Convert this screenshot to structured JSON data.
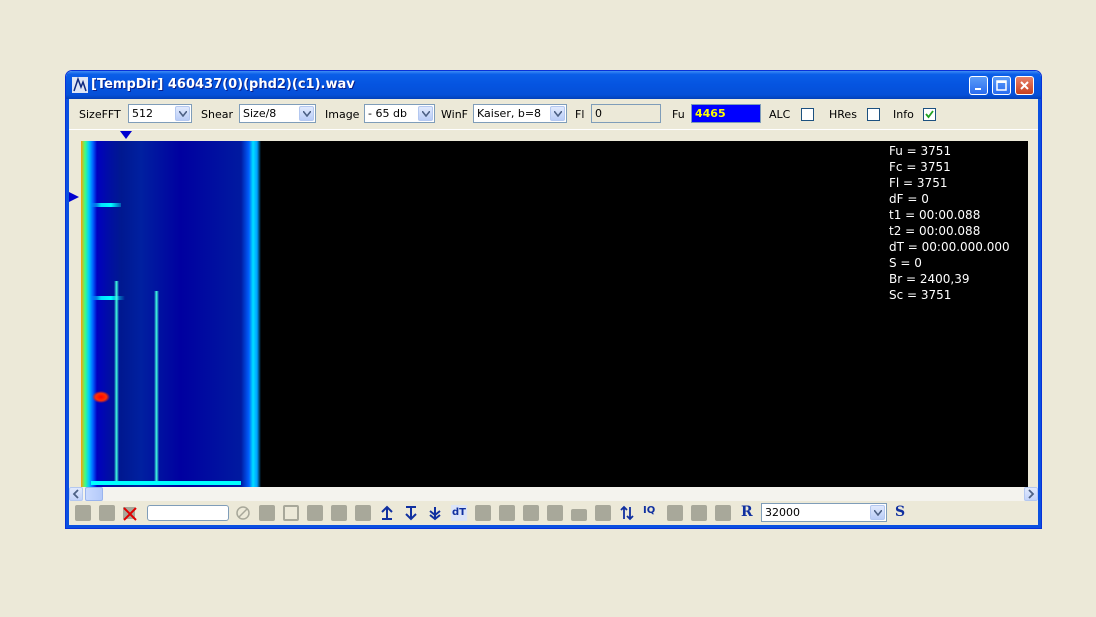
{
  "window": {
    "title": "[TempDir] 460437(0)(phd2)(c1).wav"
  },
  "toolbar": {
    "sizefft_label": "SizeFFT",
    "sizefft_value": "512",
    "shear_label": "Shear",
    "shear_value": "Size/8",
    "image_label": "Image",
    "image_value": "- 65 db",
    "winf_label": "WinF",
    "winf_value": "Kaiser, b=8",
    "fl_label": "Fl",
    "fl_value": "0",
    "fu_label": "Fu",
    "fu_value": "4465",
    "alc_label": "ALC",
    "alc_checked": false,
    "hres_label": "HRes",
    "hres_checked": false,
    "info_label": "Info",
    "info_checked": true
  },
  "info_lines": {
    "fu": "Fu = 3751",
    "fc": "Fc = 3751",
    "fl": "Fl = 3751",
    "df": "dF = 0",
    "t1": "t1 = 00:00.088",
    "t2": "t2 = 00:00.088",
    "dt": "dT = 00:00.000.000",
    "s": "S = 0",
    "br": "Br = 2400,39",
    "sc": "Sc = 3751"
  },
  "bottombar": {
    "dt_button": "dT",
    "iq_button": "IQ",
    "r_button": "R",
    "sample_rate_value": "32000",
    "s_button": "S"
  },
  "colors": {
    "title_blue": "#0554e0",
    "fu_bg": "#0000ff",
    "fu_text": "#ffff00",
    "display_bg": "#000000"
  },
  "icons": [
    "app-icon",
    "minimize-icon",
    "maximize-icon",
    "close-icon",
    "chevron-down-icon",
    "checkmark-icon",
    "scroll-left-icon",
    "scroll-right-icon",
    "delete-icon",
    "cancel-icon",
    "arrow-up-down-icon"
  ]
}
